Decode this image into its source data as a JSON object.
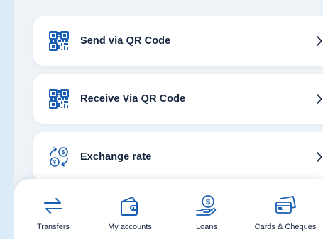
{
  "menu": [
    {
      "label": "Send via QR Code",
      "icon": "qr-code-icon"
    },
    {
      "label": "Receive Via QR Code",
      "icon": "qr-code-icon"
    },
    {
      "label": "Exchange rate",
      "icon": "exchange-rate-icon"
    }
  ],
  "bottom_nav": [
    {
      "label": "Transfers",
      "icon": "transfer-arrows-icon"
    },
    {
      "label": "My accounts",
      "icon": "wallet-icon"
    },
    {
      "label": "Loans",
      "icon": "money-hand-icon"
    },
    {
      "label": "Cards & Cheques",
      "icon": "card-cheque-icon"
    }
  ],
  "colors": {
    "accent": "#1b5fb4",
    "text": "#15243d",
    "background": "#eef3f8",
    "outer_background": "#dcebf8"
  }
}
